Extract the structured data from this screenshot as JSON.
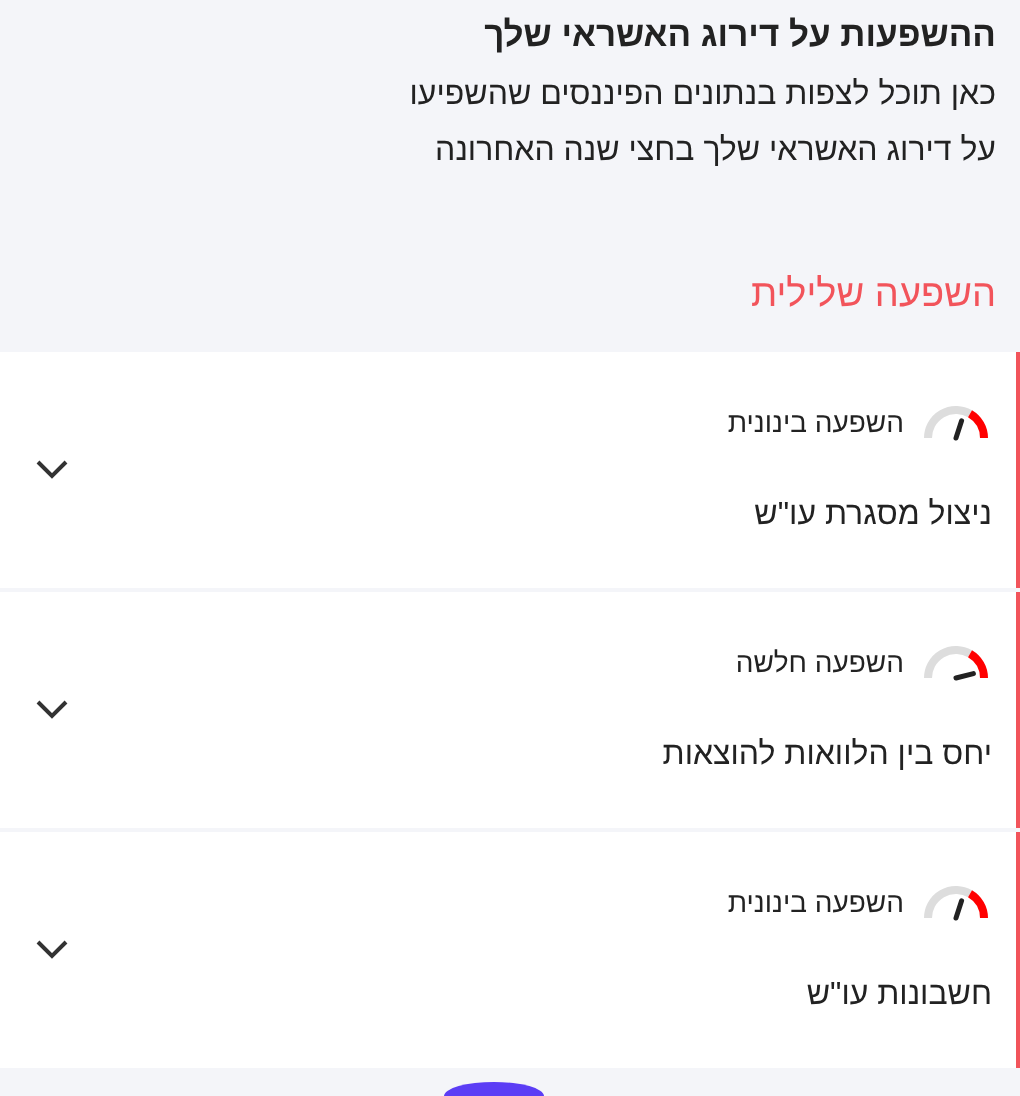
{
  "header": {
    "title": "ההשפעות על דירוג האשראי שלך",
    "lines": [
      "כאן תוכל לצפות בנתונים הפיננסים שהשפיעו",
      "על דירוג האשראי שלך בחצי שנה האחרונה"
    ]
  },
  "section": {
    "title": "השפעה שלילית"
  },
  "items": [
    {
      "impact": "השפעה בינונית",
      "kind": "medium",
      "name": "ניצול מסגרת עו\"ש",
      "expanded": false
    },
    {
      "impact": "השפעה חלשה",
      "kind": "low",
      "name": "יחס בין הלוואות להוצאות",
      "expanded": false
    },
    {
      "impact": "השפעה בינונית",
      "kind": "medium",
      "name": "חשבונות עו\"ש",
      "expanded": false
    }
  ]
}
